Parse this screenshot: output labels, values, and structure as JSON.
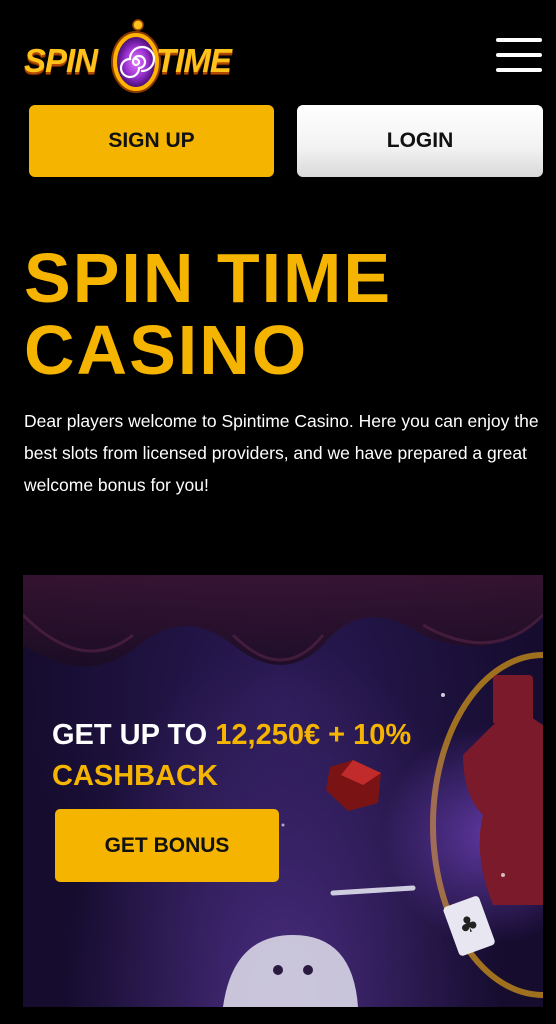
{
  "header": {
    "logo": {
      "word_left": "SPIN",
      "word_right": "TIME"
    },
    "menu_icon": "hamburger-menu-icon"
  },
  "auth": {
    "signup_label": "SIGN UP",
    "login_label": "LOGIN"
  },
  "hero": {
    "title_line1": "SPIN TIME",
    "title_line2": "CASINO",
    "description": "Dear players welcome to Spintime Casino. Here you can enjoy the best slots from licensed providers, and we have prepared a great welcome bonus for you!"
  },
  "banner": {
    "headline_white": "GET UP TO ",
    "headline_accent_amount": "12,250€ + 10%",
    "headline_accent_cashback": "CASHBACK",
    "button_label": "GET BONUS"
  },
  "colors": {
    "background": "#000000",
    "accent": "#f4b400",
    "text": "#ffffff",
    "banner_bg": "#1b1038"
  }
}
